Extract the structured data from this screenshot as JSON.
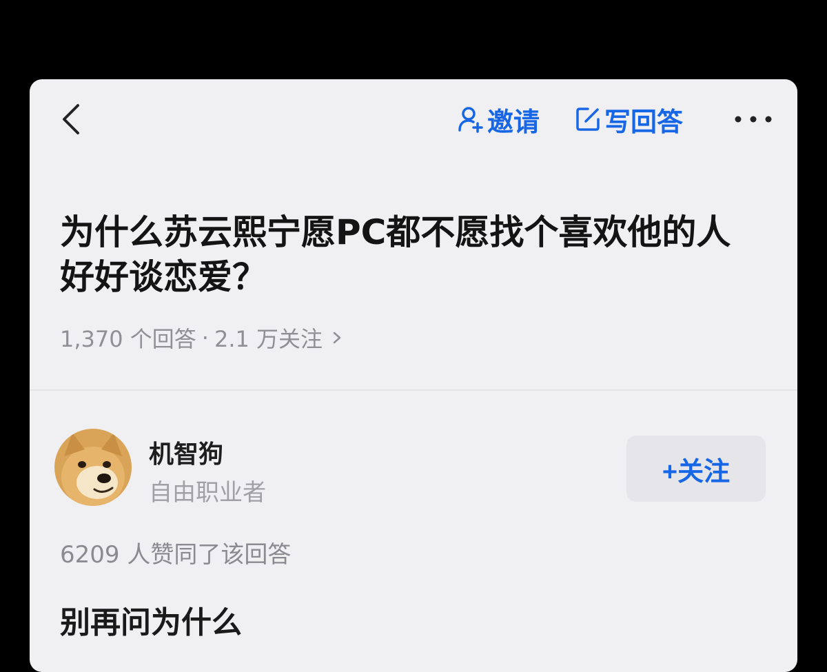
{
  "header": {
    "invite_label": "邀请",
    "write_label": "写回答",
    "accent_color": "#1766e6",
    "icons": {
      "back": "back-chevron-icon",
      "invite": "person-add-icon",
      "write": "edit-icon",
      "more": "more-dots-icon"
    }
  },
  "question": {
    "title": "为什么苏云熙宁愿PC都不愿找个喜欢他的人好好谈恋爱？",
    "answers_count": "1,370 个回答",
    "separator": "·",
    "followers_count": "2.1 万关注"
  },
  "answer": {
    "author": {
      "name": "机智狗",
      "bio": "自由职业者",
      "avatar_icon": "shiba-dog-avatar"
    },
    "follow_label": "+关注",
    "votes_text": "6209 人赞同了该回答",
    "excerpt": "别再问为什么"
  }
}
